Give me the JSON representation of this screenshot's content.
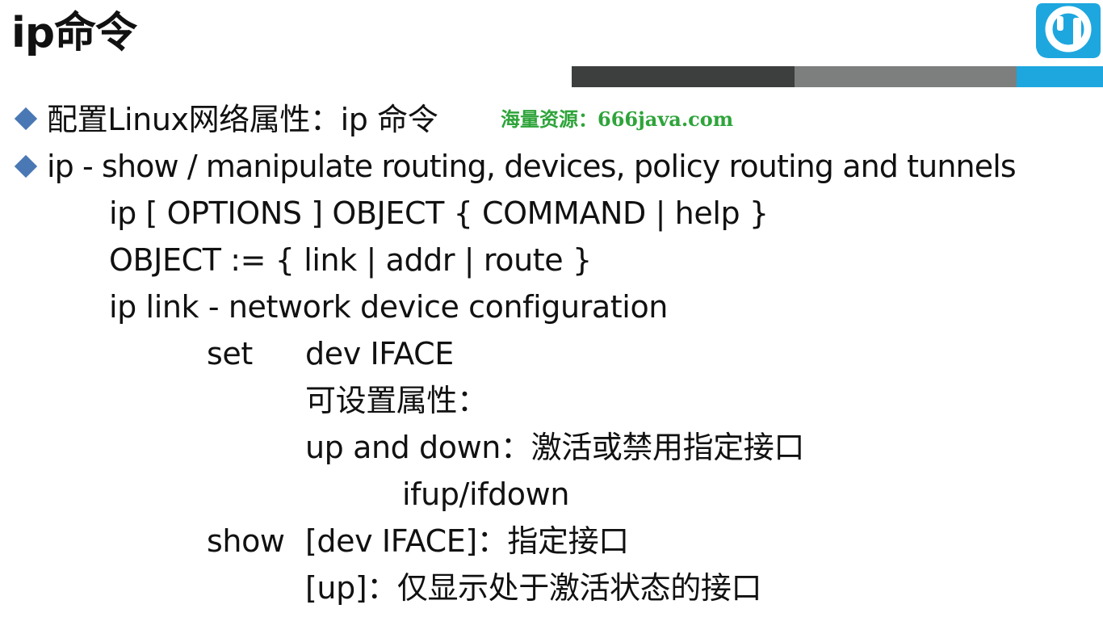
{
  "slide": {
    "title": "ip命令",
    "watermark": "海量资源：666java.com",
    "bullets": [
      "配置Linux网络属性：ip 命令",
      "ip - show / manipulate routing, devices, policy routing and tunnels"
    ],
    "lines": {
      "syntax": "ip [ OPTIONS ] OBJECT { COMMAND | help }",
      "object": "OBJECT := { link | addr | route }",
      "ip_link": "ip link - network device configuration",
      "set_label": "set",
      "set_value": "dev IFACE",
      "set_attr": "可设置属性：",
      "updown": "up and down：激活或禁用指定接口",
      "ifupdown": "ifup/ifdown",
      "show_label": "show",
      "show_value": "[dev IFACE]：指定接口",
      "up_value": "[up]：仅显示处于激活状态的接口"
    }
  },
  "colors": {
    "bar_dark": "#3d3f3e",
    "bar_grey": "#7d7f7e",
    "bar_blue": "#1ea7df",
    "bullet": "#4a78b5",
    "watermark": "#2ea43a"
  },
  "icons": {
    "logo": "logo-icon",
    "bullet": "diamond-bullet-icon"
  }
}
